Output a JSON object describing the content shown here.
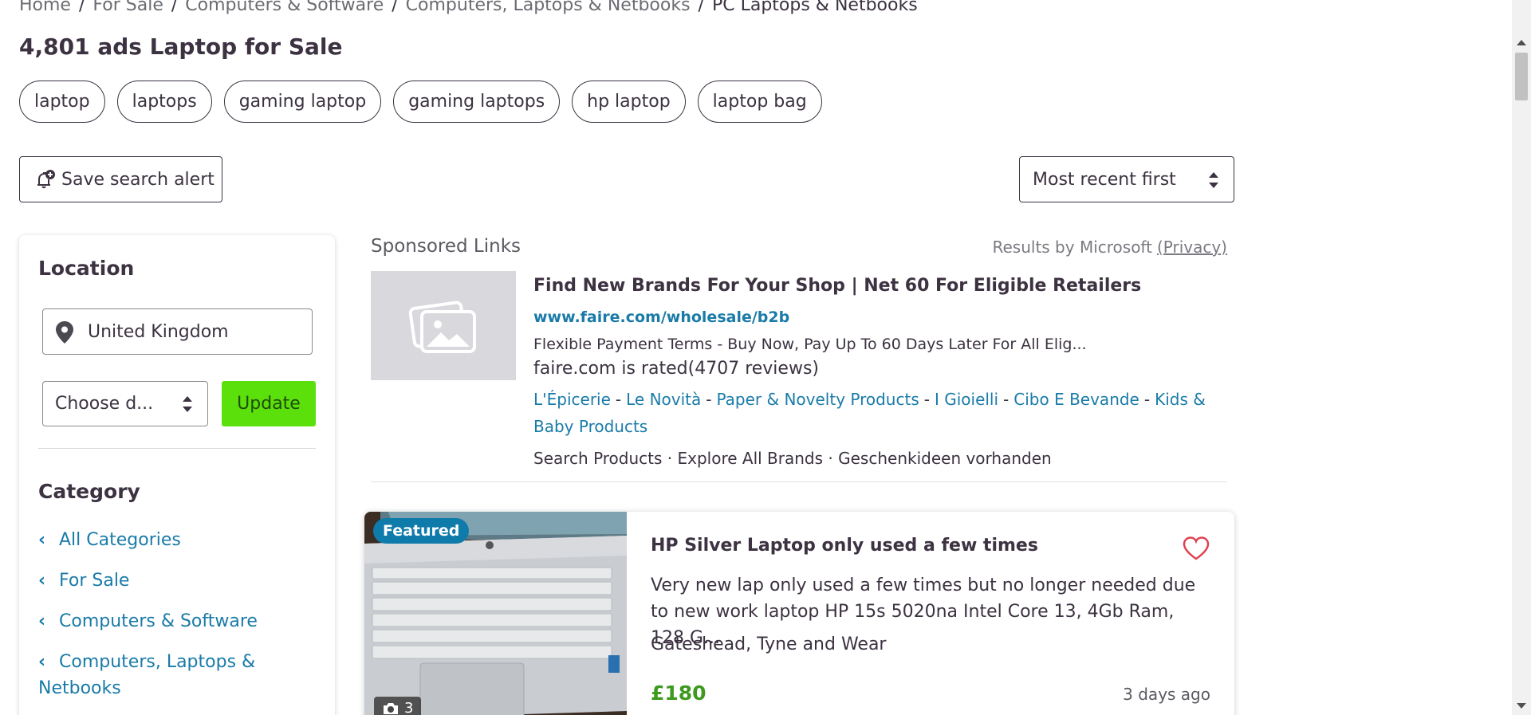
{
  "breadcrumb": {
    "items": [
      "Home",
      "For Sale",
      "Computers & Software",
      "Computers, Laptops & Netbooks"
    ],
    "current": "PC Laptops & Netbooks",
    "separator": "/"
  },
  "page_title": "4,801 ads Laptop for Sale",
  "chips": [
    "laptop",
    "laptops",
    "gaming laptop",
    "gaming laptops",
    "hp laptop",
    "laptop bag"
  ],
  "toolbar": {
    "save_alert_label": "Save search alert",
    "sort_value": "Most recent first"
  },
  "sidebar": {
    "location_heading": "Location",
    "location_value": "United Kingdom",
    "distance_value": "Choose d...",
    "update_label": "Update",
    "category_heading": "Category",
    "categories": [
      "All Categories",
      "For Sale",
      "Computers & Software",
      "Computers, Laptops & Netbooks"
    ]
  },
  "sponsored": {
    "heading": "Sponsored Links",
    "results_by": "Results by Microsoft",
    "privacy": "(Privacy)",
    "ad": {
      "title": "Find New Brands For Your Shop | Net 60 For Eligible Retailers",
      "url": "www.faire.com/wholesale/b2b",
      "description": "Flexible Payment Terms - Buy Now, Pay Up To 60 Days Later For All Elig...",
      "rating": "faire.com is rated(4707 reviews)",
      "links": [
        "L'Épicerie",
        "Le Novità",
        "Paper & Novelty Products",
        "I Gioielli",
        "Cibo E Bevande",
        "Kids & Baby Products"
      ],
      "bottom_links": "Search Products · Explore All Brands · Geschenkideen vorhanden"
    }
  },
  "listing": {
    "badge": "Featured",
    "photo_count": "3",
    "title": "HP Silver Laptop only used a few times",
    "description": "Very new lap only used a few times but no longer needed due to new work laptop HP 15s 5020na Intel Core 13, 4Gb Ram, 128 G...",
    "location": "Gateshead, Tyne and Wear",
    "price": "£180",
    "time": "3 days ago"
  },
  "colors": {
    "link_blue": "#1a7ba8",
    "update_green": "#5ce00b",
    "price_green": "#3d9a1e",
    "text_dark": "#3c3241",
    "badge_blue": "#0f7bab",
    "heart_red": "#e0414f"
  }
}
